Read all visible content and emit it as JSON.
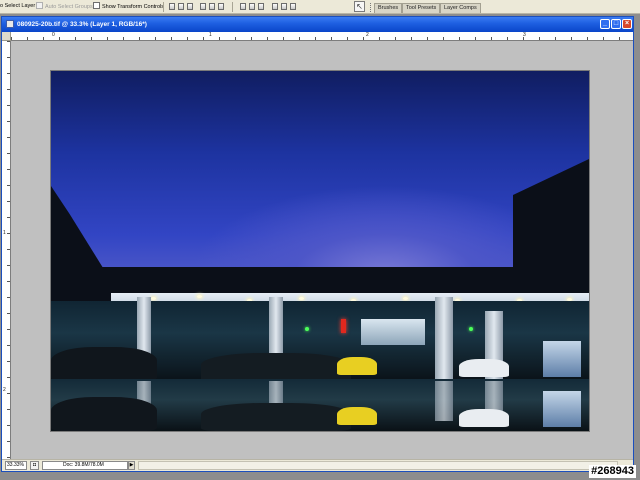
{
  "options_bar": {
    "auto_select_layer_label": "o Select Layer",
    "auto_select_groups_label": "Auto Select Groups",
    "show_transform_controls_label": "Show Transform Controls",
    "panel_well_tabs": [
      "Brushes",
      "Tool Presets",
      "Layer Comps"
    ]
  },
  "document": {
    "title": "080925-20b.tif @ 33.3% (Layer 1, RGB/16*)",
    "window_buttons": {
      "minimize": "_",
      "maximize": "□",
      "close": "×"
    },
    "ruler_top_labels": [
      "0",
      "1",
      "2",
      "3"
    ],
    "ruler_left_labels": [
      "1",
      "2"
    ]
  },
  "status_bar": {
    "zoom": "33.33%",
    "doc_info": "Doc: 39.8M/78.0M",
    "arrow": "▶"
  },
  "overlay": {
    "image_id_tag": "#268943"
  }
}
